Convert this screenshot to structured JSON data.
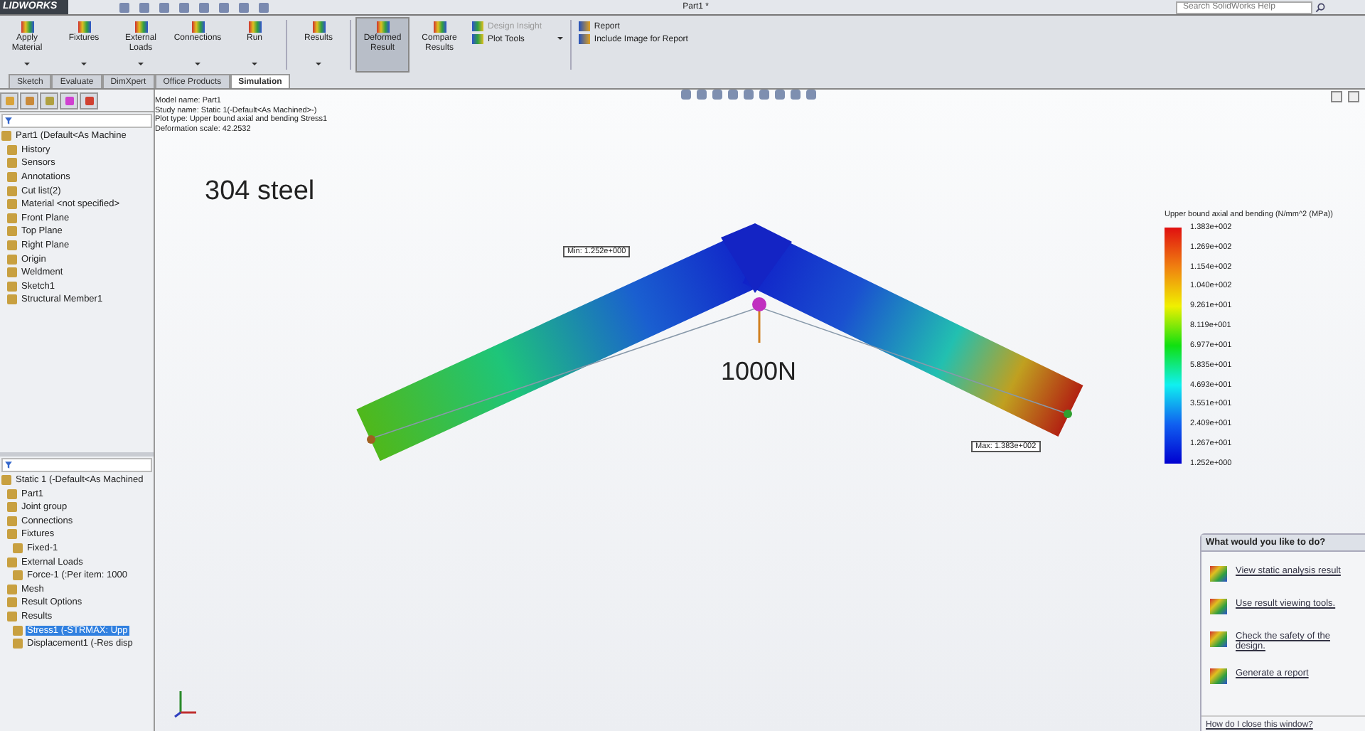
{
  "window": {
    "logo": "LIDWORKS",
    "title": "Part1 *",
    "search": {
      "placeholder": "Search SolidWorks Help"
    }
  },
  "ribbon": {
    "large_buttons": [
      {
        "label": "Apply Material",
        "dropdown": true,
        "selected": false
      },
      {
        "label": "Fixtures",
        "dropdown": true,
        "selected": false
      },
      {
        "label": "External Loads",
        "dropdown": true,
        "selected": false
      },
      {
        "label": "Connections",
        "dropdown": true,
        "selected": false
      },
      {
        "label": "Run",
        "dropdown": true,
        "selected": false
      },
      {
        "label": "Results",
        "dropdown": true,
        "selected": false
      },
      {
        "label": "Deformed Result",
        "dropdown": false,
        "selected": true
      },
      {
        "label": "Compare Results",
        "dropdown": false,
        "selected": false
      }
    ],
    "small_buttons": [
      {
        "label": "Design Insight",
        "disabled": true,
        "dropdown": false
      },
      {
        "label": "Plot Tools",
        "disabled": false,
        "dropdown": true
      }
    ],
    "report_buttons": [
      {
        "label": "Report"
      },
      {
        "label": "Include Image for Report"
      }
    ]
  },
  "tabs": [
    {
      "label": "Sketch",
      "selected": false
    },
    {
      "label": "Evaluate",
      "selected": false
    },
    {
      "label": "DimXpert",
      "selected": false
    },
    {
      "label": "Office Products",
      "selected": false
    },
    {
      "label": "Simulation",
      "selected": true
    }
  ],
  "feature_tree": [
    {
      "label": "Part1  (Default<As Machine",
      "selected": false,
      "children": [
        {
          "label": "History",
          "selected": false
        },
        {
          "label": "Sensors",
          "selected": false
        },
        {
          "label": "Annotations",
          "selected": false
        },
        {
          "label": "Cut list(2)",
          "selected": false
        },
        {
          "label": "Material <not specified>",
          "selected": false
        },
        {
          "label": "Front Plane",
          "selected": false
        },
        {
          "label": "Top Plane",
          "selected": false
        },
        {
          "label": "Right Plane",
          "selected": false
        },
        {
          "label": "Origin",
          "selected": false
        },
        {
          "label": "Weldment",
          "selected": false
        },
        {
          "label": "Sketch1",
          "selected": false
        },
        {
          "label": "Structural Member1",
          "selected": false
        }
      ]
    }
  ],
  "study_tree": [
    {
      "label": "Static 1 (-Default<As Machined",
      "selected": false,
      "children": [
        {
          "label": "Part1",
          "selected": false
        },
        {
          "label": "Joint group",
          "selected": false
        },
        {
          "label": "Connections",
          "selected": false
        },
        {
          "label": "Fixtures",
          "selected": false,
          "children": [
            {
              "label": "Fixed-1",
              "selected": false
            }
          ]
        },
        {
          "label": "External Loads",
          "selected": false,
          "children": [
            {
              "label": "Force-1 (:Per item: 1000",
              "selected": false
            }
          ]
        },
        {
          "label": "Mesh",
          "selected": false
        },
        {
          "label": "Result Options",
          "selected": false
        },
        {
          "label": "Results",
          "selected": false,
          "children": [
            {
              "label": "Stress1 (-STRMAX: Upp",
              "selected": true
            },
            {
              "label": "Displacement1 (-Res disp",
              "selected": false
            }
          ]
        }
      ]
    }
  ],
  "viewport": {
    "info": [
      "Model name: Part1",
      "Study name: Static 1(-Default<As Machined>-)",
      "Plot type: Upper bound axial and bending Stress1",
      "Deformation scale: 42.2532"
    ],
    "material_note": "304 steel",
    "load_label": "1000N",
    "min_label": "Min: 1.252e+000",
    "max_label": "Max: 1.383e+002",
    "legend": {
      "title": "Upper bound axial and bending (N/mm^2 (MPa))",
      "ticks": [
        "1.383e+002",
        "1.269e+002",
        "1.154e+002",
        "1.040e+002",
        "9.261e+001",
        "8.119e+001",
        "6.977e+001",
        "5.835e+001",
        "4.693e+001",
        "3.551e+001",
        "2.409e+001",
        "1.267e+001",
        "1.252e+000"
      ]
    }
  },
  "task_pane": {
    "title": "What would you like to do?",
    "links": [
      "View static analysis result",
      "Use result viewing tools.",
      "Check the safety of the design.",
      "Generate a report"
    ],
    "footer_link": "How do I close this window?"
  }
}
